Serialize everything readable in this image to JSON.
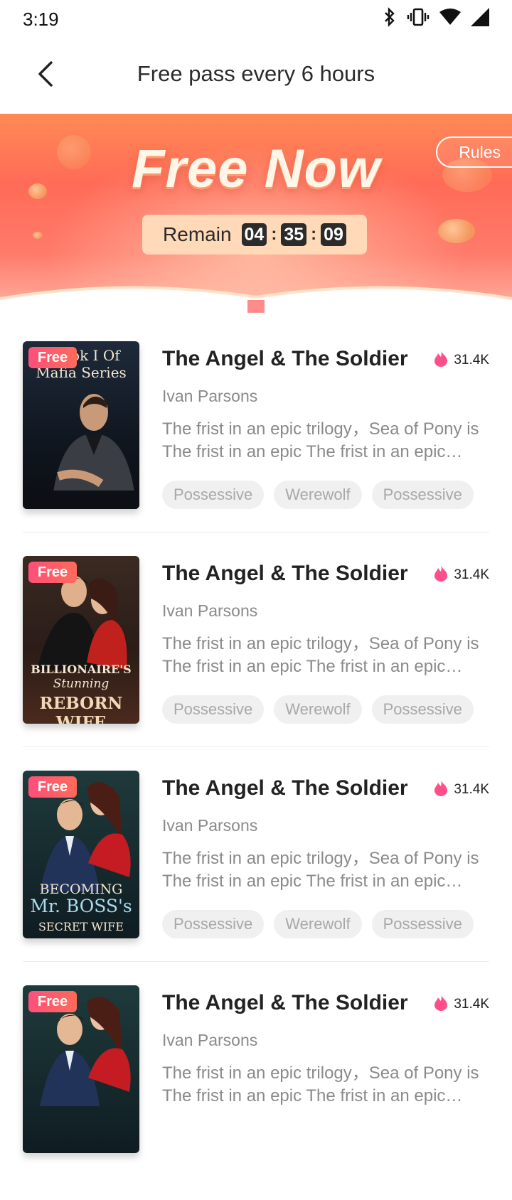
{
  "status_bar": {
    "time": "3:19",
    "icons": [
      "bluetooth-icon",
      "vibrate-icon",
      "wifi-icon",
      "cellular-signal-icon"
    ]
  },
  "header": {
    "title": "Free pass every 6 hours",
    "back_icon": "back-arrow-icon"
  },
  "banner": {
    "title": "Free Now",
    "rules_label": "Rules",
    "timer": {
      "label": "Remain",
      "hours": "04",
      "minutes": "35",
      "seconds": "09",
      "separator": ":"
    }
  },
  "books": [
    {
      "badge": "Free",
      "title": "The Angel & The Soldier",
      "heat": "31.4K",
      "author": "Ivan Parsons",
      "description": "The frist in an epic trilogy，Sea of Pony is The frist in an epic The frist in an epic trilogy",
      "tags": [
        "Possessive",
        "Werewolf",
        "Possessive"
      ],
      "cover_text_top": "ook I Of",
      "cover_text_bottom": "Mafia Series"
    },
    {
      "badge": "Free",
      "title": "The Angel & The Soldier",
      "heat": "31.4K",
      "author": "Ivan Parsons",
      "description": "The frist in an epic trilogy，Sea of Pony is The frist in an epic The frist in an epic trilogy",
      "tags": [
        "Possessive",
        "Werewolf",
        "Possessive"
      ],
      "cover_text_top": "BILLIONAIRE'S",
      "cover_text_mid": "Stunning",
      "cover_text_bottom": "REBORN WIFE"
    },
    {
      "badge": "Free",
      "title": "The Angel & The Soldier",
      "heat": "31.4K",
      "author": "Ivan Parsons",
      "description": "The frist in an epic trilogy，Sea of Pony is The frist in an epic The frist in an epic trilogy",
      "tags": [
        "Possessive",
        "Werewolf",
        "Possessive"
      ],
      "cover_text_top": "BECOMING",
      "cover_text_mid": "Mr. BOSS's",
      "cover_text_bottom": "SECRET WIFE"
    },
    {
      "badge": "Free",
      "title": "The Angel & The Soldier",
      "heat": "31.4K",
      "author": "Ivan Parsons",
      "description": "The frist in an epic trilogy，Sea of Pony is The frist in an epic The frist in an epic trilogy",
      "tags": [
        "Possessive",
        "Werewolf",
        "Possessive"
      ]
    }
  ],
  "colors": {
    "accent": "#ff4f7a",
    "banner_orange": "#ff7a5a",
    "heat_pink": "#ff4f8b"
  }
}
